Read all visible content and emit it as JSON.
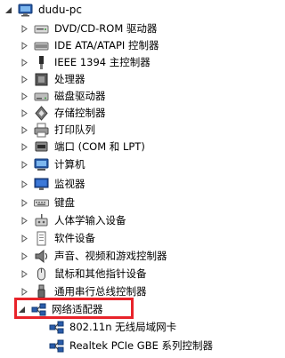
{
  "root": {
    "label": "dudu-pc",
    "icon": "computer-icon"
  },
  "items": [
    {
      "label": "DVD/CD-ROM 驱动器",
      "icon": "dvd-drive-icon"
    },
    {
      "label": "IDE ATA/ATAPI 控制器",
      "icon": "ide-controller-icon"
    },
    {
      "label": "IEEE 1394 主控制器",
      "icon": "firewire-icon"
    },
    {
      "label": "处理器",
      "icon": "processor-icon"
    },
    {
      "label": "磁盘驱动器",
      "icon": "disk-drive-icon"
    },
    {
      "label": "存储控制器",
      "icon": "storage-controller-icon"
    },
    {
      "label": "打印队列",
      "icon": "printer-icon"
    },
    {
      "label": "端口 (COM 和 LPT)",
      "icon": "port-icon"
    },
    {
      "label": "计算机",
      "icon": "computer-icon"
    },
    {
      "label": "监视器",
      "icon": "monitor-icon"
    },
    {
      "label": "键盘",
      "icon": "keyboard-icon"
    },
    {
      "label": "人体学输入设备",
      "icon": "hid-icon"
    },
    {
      "label": "软件设备",
      "icon": "software-device-icon"
    },
    {
      "label": "声音、视频和游戏控制器",
      "icon": "sound-icon"
    },
    {
      "label": "鼠标和其他指针设备",
      "icon": "mouse-icon"
    },
    {
      "label": "通用串行总线控制器",
      "icon": "usb-icon"
    },
    {
      "label": "网络适配器",
      "icon": "network-adapter-icon",
      "expanded": true,
      "highlighted": true
    }
  ],
  "children": [
    {
      "label": "802.11n 无线局域网卡",
      "icon": "network-adapter-icon"
    },
    {
      "label": "Realtek PCIe GBE 系列控制器",
      "icon": "network-adapter-icon"
    }
  ],
  "colors": {
    "highlight_border": "#e8232a",
    "expander_arrow": "#5a5a5a",
    "text": "#000000"
  }
}
